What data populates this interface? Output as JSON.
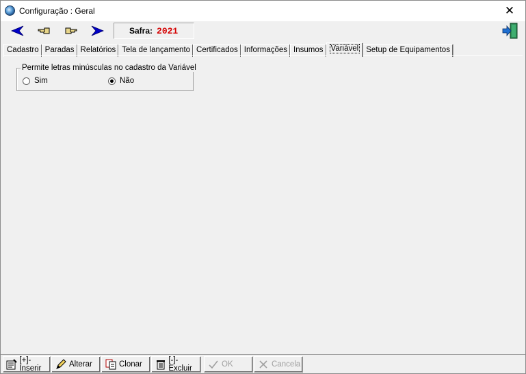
{
  "window": {
    "title": "Configuração : Geral",
    "close_glyph": "✕"
  },
  "toolbar": {
    "buttons": [
      {
        "name": "previous-arrow-icon"
      },
      {
        "name": "hand-point-left-icon"
      },
      {
        "name": "hand-point-right-icon"
      },
      {
        "name": "next-arrow-icon"
      }
    ],
    "safra_label": "Safra:",
    "safra_year": "2021",
    "exit_icon": "exit-door-icon"
  },
  "tabs": [
    {
      "label": "Cadastro",
      "active": false
    },
    {
      "label": "Paradas",
      "active": false
    },
    {
      "label": "Relatórios",
      "active": false
    },
    {
      "label": "Tela de lançamento",
      "active": false
    },
    {
      "label": "Certificados",
      "active": false
    },
    {
      "label": "Informações",
      "active": false
    },
    {
      "label": "Insumos",
      "active": false
    },
    {
      "label": "Variável",
      "active": true
    },
    {
      "label": "Setup de Equipamentos",
      "active": false
    }
  ],
  "group": {
    "legend": "Permite letras minúsculas no cadastro da Variável",
    "options": [
      {
        "label": "Sim",
        "checked": false
      },
      {
        "label": "Não",
        "checked": true
      }
    ]
  },
  "bottom_buttons": {
    "insert": "[+]-Inserir",
    "alter": "Alterar",
    "clone": "Clonar",
    "delete": "[-]-Excluir",
    "ok": "OK",
    "cancel": "Cancela"
  },
  "colors": {
    "safra_year": "#d40000",
    "arrow_blue": "#0000c8",
    "exit_green": "#2e8b57"
  }
}
